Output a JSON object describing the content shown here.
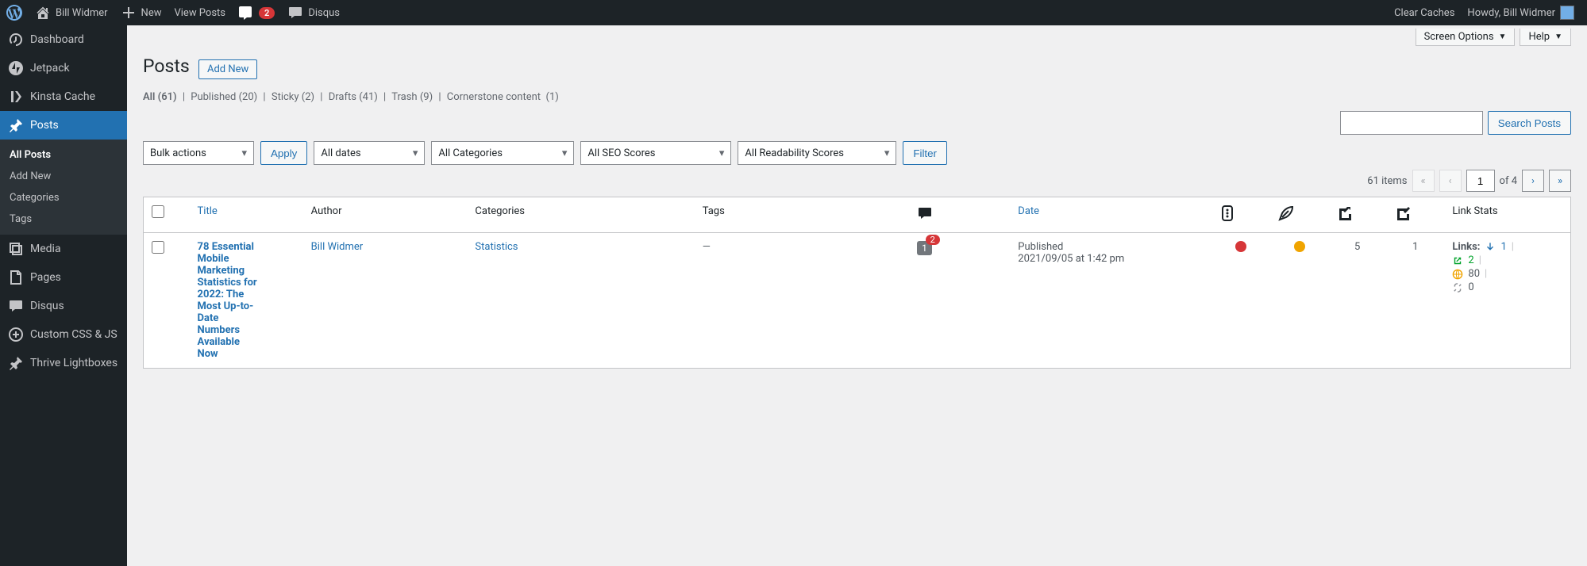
{
  "adminbar": {
    "site_name": "Bill Widmer",
    "new_label": "New",
    "view_posts": "View Posts",
    "yoast_count": "2",
    "disqus": "Disqus",
    "clear_caches": "Clear Caches",
    "howdy": "Howdy, Bill Widmer"
  },
  "sidebar": {
    "items": [
      {
        "label": "Dashboard"
      },
      {
        "label": "Jetpack"
      },
      {
        "label": "Kinsta Cache"
      },
      {
        "label": "Posts"
      },
      {
        "label": "Media"
      },
      {
        "label": "Pages"
      },
      {
        "label": "Disqus"
      },
      {
        "label": "Custom CSS & JS"
      },
      {
        "label": "Thrive Lightboxes"
      }
    ],
    "posts_sub": [
      {
        "label": "All Posts"
      },
      {
        "label": "Add New"
      },
      {
        "label": "Categories"
      },
      {
        "label": "Tags"
      }
    ]
  },
  "page": {
    "heading": "Posts",
    "add_new": "Add New",
    "screen_options": "Screen Options",
    "help": "Help",
    "search_btn": "Search Posts"
  },
  "views": {
    "all": "All",
    "all_count": "(61)",
    "published": "Published",
    "published_count": "(20)",
    "sticky": "Sticky",
    "sticky_count": "(2)",
    "drafts": "Drafts",
    "drafts_count": "(41)",
    "trash": "Trash",
    "trash_count": "(9)",
    "cornerstone": "Cornerstone content",
    "cornerstone_count": "(1)"
  },
  "filters": {
    "bulk": "Bulk actions",
    "apply": "Apply",
    "dates": "All dates",
    "categories": "All Categories",
    "seo": "All SEO Scores",
    "readability": "All Readability Scores",
    "filter": "Filter"
  },
  "pagination": {
    "total": "61 items",
    "page": "1",
    "of": "of 4"
  },
  "columns": {
    "title": "Title",
    "author": "Author",
    "categories": "Categories",
    "tags": "Tags",
    "date": "Date",
    "linkstats": "Link Stats"
  },
  "row": {
    "title": "78 Essential Mobile Marketing Statistics for 2022: The Most Up-to-Date Numbers Available Now",
    "author": "Bill Widmer",
    "categories": "Statistics",
    "tags": "—",
    "comments": "1",
    "comments_pending": "2",
    "status": "Published",
    "date": "2021/09/05 at 1:42 pm",
    "icon1": "5",
    "icon2": "1",
    "links_label": "Links:",
    "links_in": "1",
    "links_out": "2",
    "links_ext": "80",
    "links_broken": "0"
  }
}
